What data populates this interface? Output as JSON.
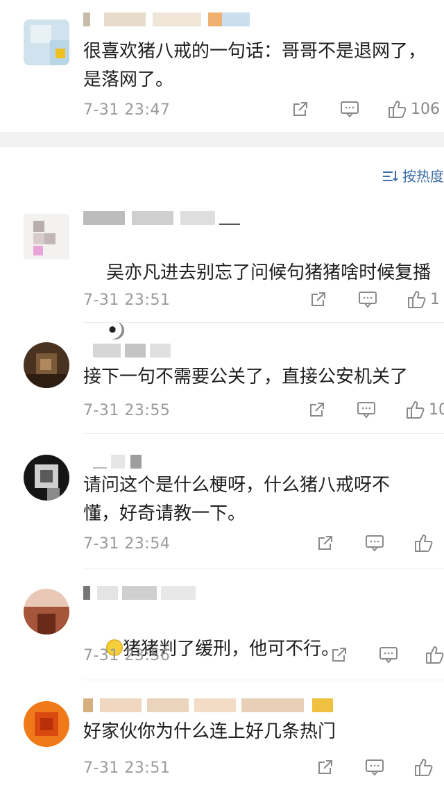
{
  "top_comment": {
    "text": "很喜欢猪八戒的一句话：哥哥不是退网了，\n是落网了。",
    "time": "7-31 23:47",
    "likes": "106"
  },
  "sort": {
    "label": "按热度"
  },
  "comments": [
    {
      "text": "吴亦凡进去别忘了问候句猪猪啥时候复播",
      "time": "7-31 23:51",
      "likes": "1"
    },
    {
      "text": "接下一句不需要公关了，直接公安机关了",
      "time": "7-31 23:55",
      "likes": "10"
    },
    {
      "text": "请问这个是什么梗呀，什么猪八戒呀不\n懂，好奇请教一下。",
      "time": "7-31 23:54",
      "likes": ""
    },
    {
      "text": "猪猪判了缓刑，他可不行。",
      "time": "7-31 23:56",
      "likes": ""
    },
    {
      "text": "好家伙你为什么连上好几条热门",
      "time": "7-31 23:51",
      "likes": ""
    }
  ],
  "colors": {
    "link": "#3c6da8",
    "time": "#9a9a9a",
    "separator": "#f2f2f2"
  }
}
